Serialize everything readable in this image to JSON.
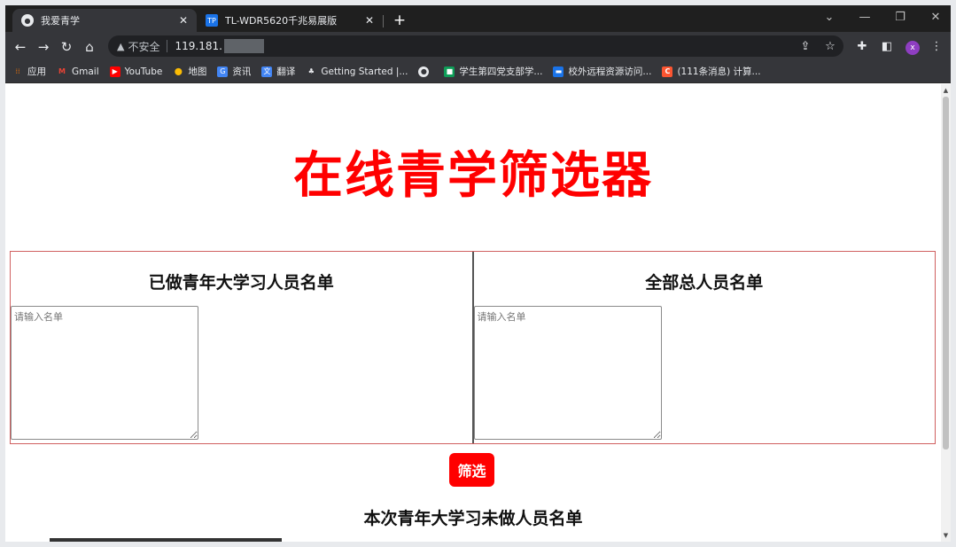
{
  "browser": {
    "tabs": [
      {
        "title": "我爱青学",
        "active": true
      },
      {
        "title": "TL-WDR5620千兆易展版",
        "active": false
      }
    ],
    "omnibox": {
      "security_label": "不安全",
      "url": "119.181."
    },
    "bookmarks": [
      {
        "label": "应用",
        "icon": "apps-grid-icon",
        "color": "#e8710a"
      },
      {
        "label": "Gmail",
        "icon": "gmail-icon",
        "color": "#ea4335"
      },
      {
        "label": "YouTube",
        "icon": "youtube-icon",
        "color": "#ff0000"
      },
      {
        "label": "地图",
        "icon": "maps-pin-icon",
        "color": "#34a853"
      },
      {
        "label": "资讯",
        "icon": "news-icon",
        "color": "#4285f4"
      },
      {
        "label": "翻译",
        "icon": "translate-icon",
        "color": "#4285f4"
      },
      {
        "label": "Getting Started |...",
        "icon": "getting-started-icon",
        "color": "#5c5c5c"
      },
      {
        "label": "",
        "icon": "globe-icon",
        "color": "#e8eaed"
      },
      {
        "label": "学生第四党支部学...",
        "icon": "party-branch-icon",
        "color": "#0f9d58"
      },
      {
        "label": "校外远程资源访问...",
        "icon": "remote-access-icon",
        "color": "#1a73e8"
      },
      {
        "label": "(111条消息) 计算...",
        "icon": "csdn-icon",
        "color": "#fc5531"
      }
    ]
  },
  "page": {
    "title": "在线青学筛选器",
    "done_panel": {
      "heading": "已做青年大学习人员名单",
      "placeholder": "请输入名单"
    },
    "all_panel": {
      "heading": "全部总人员名单",
      "placeholder": "请输入名单"
    },
    "filter_button": "筛选",
    "result_heading": "本次青年大学习未做人员名单"
  },
  "colors": {
    "title_red": "#ff0000",
    "button_red": "#ff0000",
    "panel_border": "#d06060"
  }
}
